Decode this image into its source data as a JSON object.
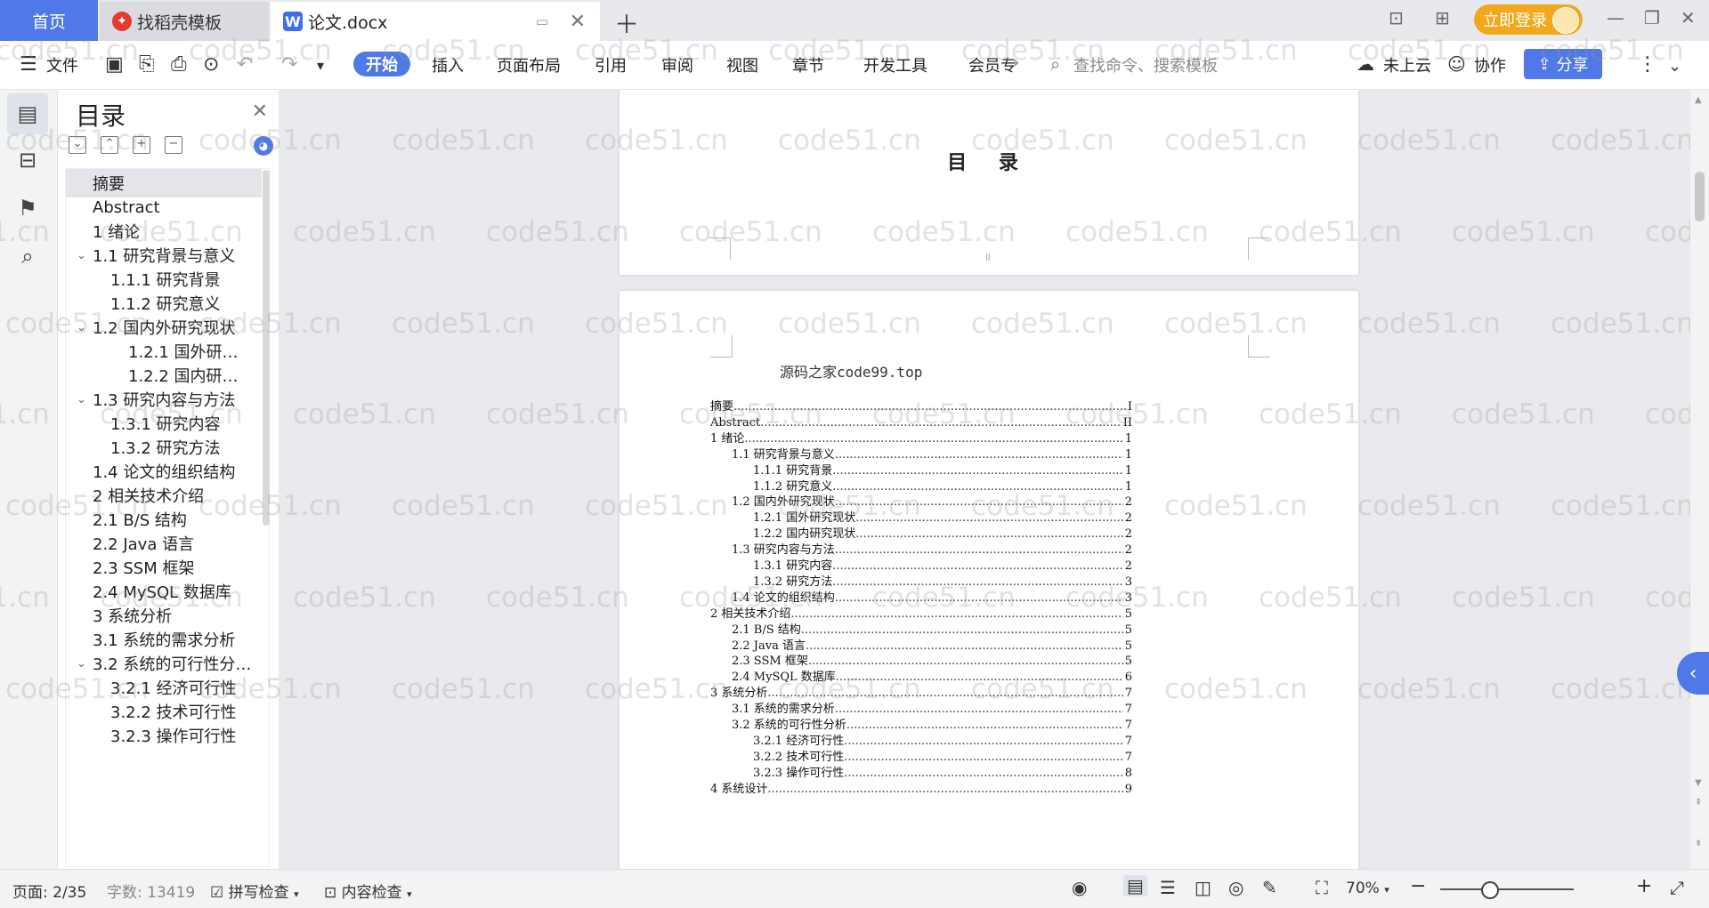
{
  "tabs": {
    "home": "首页",
    "template": "找稻壳模板",
    "document": "论文.docx",
    "login": "立即登录"
  },
  "menu": {
    "file": "文件",
    "items": [
      "开始",
      "插入",
      "页面布局",
      "引用",
      "审阅",
      "视图",
      "章节",
      "开发工具",
      "会员专"
    ],
    "search_placeholder": "查找命令、搜索模板",
    "cloud": "未上云",
    "collab": "协作",
    "share": "分享"
  },
  "toc_panel": {
    "title": "目录",
    "items": [
      {
        "label": "摘要",
        "level": 1,
        "selected": true
      },
      {
        "label": "Abstract",
        "level": 1
      },
      {
        "label": "1 绪论",
        "level": 1
      },
      {
        "label": "1.1 研究背景与意义",
        "level": 1,
        "expanded": true
      },
      {
        "label": "1.1.1 研究背景",
        "level": 2
      },
      {
        "label": "1.1.2 研究意义",
        "level": 2
      },
      {
        "label": "1.2 国内外研究现状",
        "level": 1,
        "expanded": true
      },
      {
        "label": "1.2.1 国外研…",
        "level": 3
      },
      {
        "label": "1.2.2 国内研…",
        "level": 3
      },
      {
        "label": "1.3 研究内容与方法",
        "level": 1,
        "expanded": true
      },
      {
        "label": "1.3.1 研究内容",
        "level": 2
      },
      {
        "label": "1.3.2 研究方法",
        "level": 2
      },
      {
        "label": "1.4 论文的组织结构",
        "level": 1
      },
      {
        "label": "2 相关技术介绍",
        "level": 1
      },
      {
        "label": "2.1 B/S 结构",
        "level": 1
      },
      {
        "label": "2.2 Java 语言",
        "level": 1
      },
      {
        "label": "2.3 SSM 框架",
        "level": 1
      },
      {
        "label": "2.4 MySQL 数据库",
        "level": 1
      },
      {
        "label": "3 系统分析",
        "level": 1
      },
      {
        "label": "3.1 系统的需求分析",
        "level": 1
      },
      {
        "label": "3.2 系统的可行性分…",
        "level": 1,
        "expanded": true
      },
      {
        "label": "3.2.1 经济可行性",
        "level": 2
      },
      {
        "label": "3.2.2 技术可行性",
        "level": 2
      },
      {
        "label": "3.2.3 操作可行性",
        "level": 2
      }
    ]
  },
  "document": {
    "page1_title": "目 录",
    "overlay": "源码之家code99.top",
    "toc_entries": [
      {
        "label": "摘要",
        "page": "I",
        "indent": 0
      },
      {
        "label": "Abstract",
        "page": "II",
        "indent": 0
      },
      {
        "label": "1 绪论",
        "page": "1",
        "indent": 0
      },
      {
        "label": "1.1 研究背景与意义",
        "page": "1",
        "indent": 1
      },
      {
        "label": "1.1.1 研究背景",
        "page": "1",
        "indent": 2
      },
      {
        "label": "1.1.2 研究意义",
        "page": "1",
        "indent": 2
      },
      {
        "label": "1.2 国内外研究现状",
        "page": "2",
        "indent": 1
      },
      {
        "label": "1.2.1 国外研究现状",
        "page": "2",
        "indent": 2
      },
      {
        "label": "1.2.2 国内研究现状",
        "page": "2",
        "indent": 2
      },
      {
        "label": "1.3 研究内容与方法",
        "page": "2",
        "indent": 1
      },
      {
        "label": "1.3.1 研究内容",
        "page": "2",
        "indent": 2
      },
      {
        "label": "1.3.2 研究方法",
        "page": "3",
        "indent": 2
      },
      {
        "label": "1.4 论文的组织结构",
        "page": "3",
        "indent": 1
      },
      {
        "label": "2 相关技术介绍",
        "page": "5",
        "indent": 0
      },
      {
        "label": "2.1 B/S 结构",
        "page": "5",
        "indent": 1
      },
      {
        "label": "2.2 Java 语言",
        "page": "5",
        "indent": 1
      },
      {
        "label": "2.3 SSM 框架",
        "page": "5",
        "indent": 1
      },
      {
        "label": "2.4 MySQL 数据库",
        "page": "6",
        "indent": 1
      },
      {
        "label": "3 系统分析",
        "page": "7",
        "indent": 0
      },
      {
        "label": "3.1 系统的需求分析",
        "page": "7",
        "indent": 1
      },
      {
        "label": "3.2 系统的可行性分析",
        "page": "7",
        "indent": 1
      },
      {
        "label": "3.2.1 经济可行性",
        "page": "7",
        "indent": 2
      },
      {
        "label": "3.2.2 技术可行性",
        "page": "7",
        "indent": 2
      },
      {
        "label": "3.2.3 操作可行性",
        "page": "8",
        "indent": 2
      },
      {
        "label": "4 系统设计",
        "page": "9",
        "indent": 0
      }
    ]
  },
  "watermark": "code51.cn",
  "status": {
    "page": "页面: 2/35",
    "wordcount": "字数: 13419",
    "spellcheck": "拼写检查",
    "contentcheck": "内容检查",
    "zoom": "70%",
    "zoom_fraction": 0.37
  },
  "colors": {
    "accent": "#4f79e8",
    "login": "#f2a81d"
  }
}
